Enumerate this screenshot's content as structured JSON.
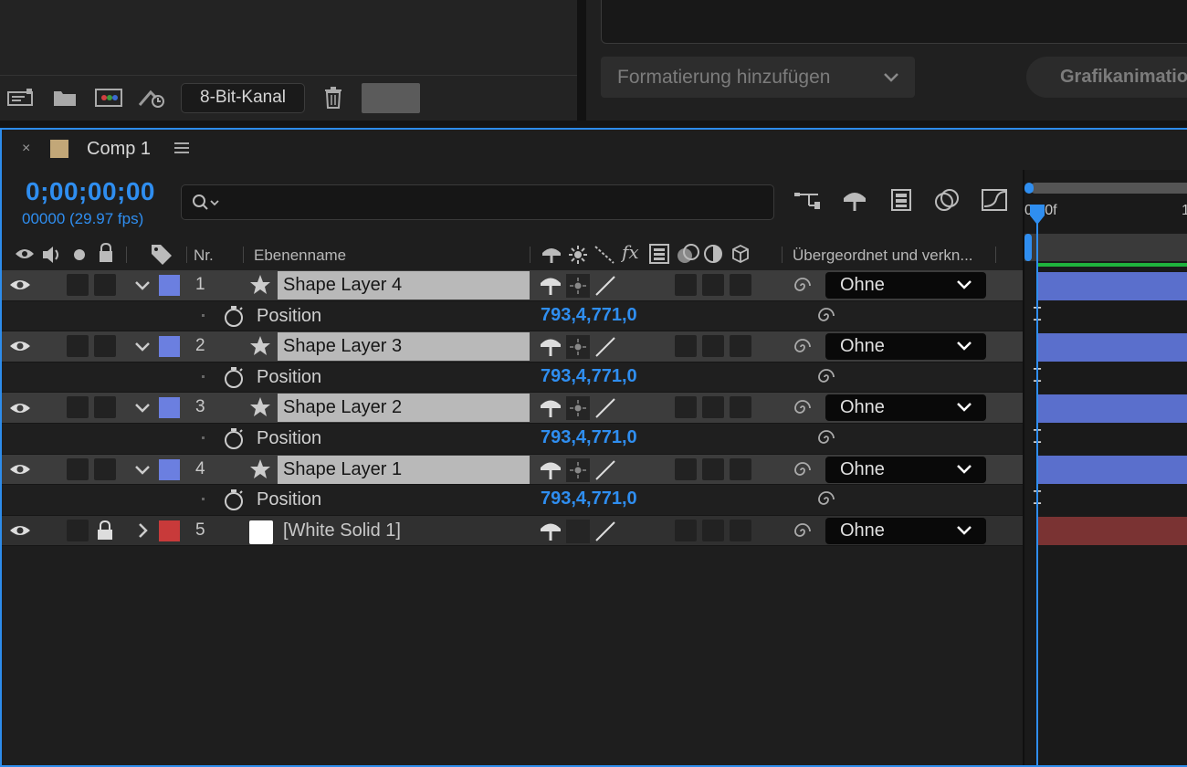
{
  "project_panel": {
    "bit_depth_label": "8-Bit-Kanal",
    "icons": [
      "interpret-footage-icon",
      "new-folder-icon",
      "new-composition-icon",
      "project-flowchart-icon",
      "delete-icon"
    ]
  },
  "essential_graphics": {
    "format_button_label": "Formatierung hinzufügen",
    "animation_button_label": "Grafikanimation"
  },
  "timeline": {
    "tab": {
      "close": "×",
      "title": "Comp 1",
      "menu": "≡",
      "color": "#c2a778"
    },
    "timecode": "0;00;00;00",
    "fps": "00000 (29.97 fps)",
    "search_placeholder": "",
    "ruler": {
      "start_label": "0:00f",
      "end_label": "1"
    },
    "headers": {
      "nr": "Nr.",
      "layer_name": "Ebenenname",
      "parent": "Übergeordnet und verkn..."
    },
    "layers": [
      {
        "nr": "1",
        "name": "Shape Layer 4",
        "parent": "Ohne",
        "label_color": "#6b7fe0",
        "prop_name": "Position",
        "prop_value": "793,4,771,0"
      },
      {
        "nr": "2",
        "name": "Shape Layer 3",
        "parent": "Ohne",
        "label_color": "#6b7fe0",
        "prop_name": "Position",
        "prop_value": "793,4,771,0"
      },
      {
        "nr": "3",
        "name": "Shape Layer 2",
        "parent": "Ohne",
        "label_color": "#6b7fe0",
        "prop_name": "Position",
        "prop_value": "793,4,771,0"
      },
      {
        "nr": "4",
        "name": "Shape Layer 1",
        "parent": "Ohne",
        "label_color": "#6b7fe0",
        "prop_name": "Position",
        "prop_value": "793,4,771,0"
      }
    ],
    "solid_layer": {
      "nr": "5",
      "name": "[White Solid 1]",
      "parent": "Ohne",
      "label_color": "#c83a3a"
    },
    "accent_color": "#2f8ef0"
  }
}
